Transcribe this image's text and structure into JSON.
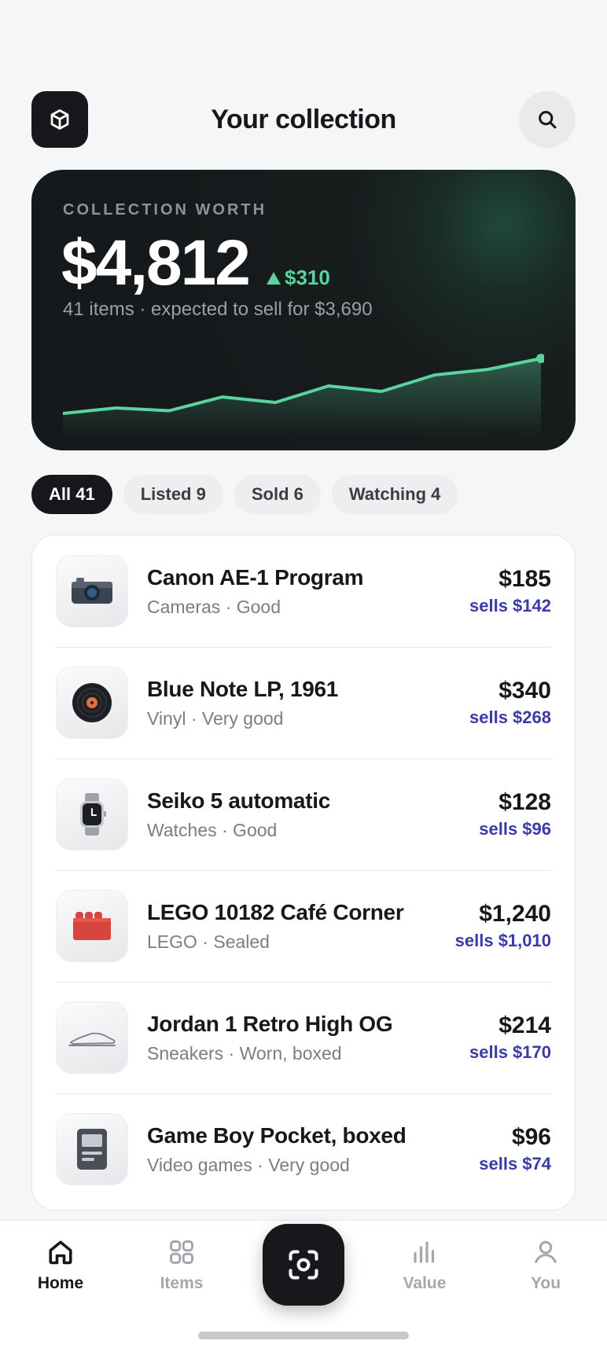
{
  "header": {
    "title": "Your collection",
    "logo_icon": "cube-icon",
    "search_icon": "search-icon"
  },
  "worth": {
    "label": "COLLECTION WORTH",
    "value": "$4,812",
    "delta": "$310",
    "delta_direction": "up",
    "subtitle": "41 items · expected to sell for $3,690",
    "accent": "#5ad39e",
    "trend": [
      12,
      16,
      14,
      24,
      20,
      32,
      28,
      40,
      44,
      52
    ]
  },
  "filters": [
    {
      "label": "All 41",
      "active": true
    },
    {
      "label": "Listed 9",
      "active": false
    },
    {
      "label": "Sold 6",
      "active": false
    },
    {
      "label": "Watching 4",
      "active": false
    }
  ],
  "items": [
    {
      "name": "Canon AE-1 Program",
      "meta": "Cameras · Good",
      "price": "$185",
      "sells": "sells $142",
      "icon": "camera-icon"
    },
    {
      "name": "Blue Note LP, 1961",
      "meta": "Vinyl · Very good",
      "price": "$340",
      "sells": "sells $268",
      "icon": "vinyl-record-icon"
    },
    {
      "name": "Seiko 5 automatic",
      "meta": "Watches · Good",
      "price": "$128",
      "sells": "sells $96",
      "icon": "watch-icon"
    },
    {
      "name": "LEGO 10182 Café Corner",
      "meta": "LEGO · Sealed",
      "price": "$1,240",
      "sells": "sells $1,010",
      "icon": "lego-brick-icon"
    },
    {
      "name": "Jordan 1 Retro High OG",
      "meta": "Sneakers · Worn, boxed",
      "price": "$214",
      "sells": "sells $170",
      "icon": "sneaker-icon"
    },
    {
      "name": "Game Boy Pocket, boxed",
      "meta": "Video games · Very good",
      "price": "$96",
      "sells": "sells $74",
      "icon": "gameboy-icon"
    }
  ],
  "tabbar": {
    "home": "Home",
    "items": "Items",
    "value": "Value",
    "you": "You",
    "scan_icon": "scan-icon"
  }
}
